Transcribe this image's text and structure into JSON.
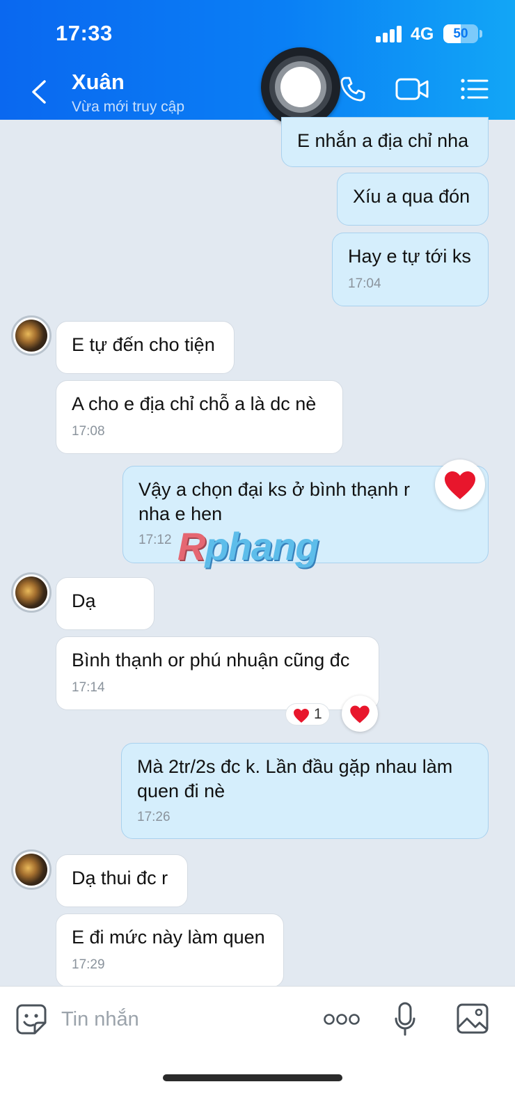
{
  "status_bar": {
    "time": "17:33",
    "network": "4G",
    "battery": "50",
    "battery_level": 0.5
  },
  "header": {
    "contact_name": "Xuân",
    "contact_status": "Vừa mới truy cập",
    "icons": [
      "chevron-left-icon",
      "phone-icon",
      "video-camera-icon",
      "list-menu-icon"
    ]
  },
  "messages": [
    {
      "direction": "out",
      "text": "E nhắn a địa chỉ nha"
    },
    {
      "direction": "out",
      "text": "Xíu a qua đón"
    },
    {
      "direction": "out",
      "text": "Hay e tự tới ks",
      "time": "17:04"
    },
    {
      "direction": "in",
      "text": "E tự đến cho tiện"
    },
    {
      "direction": "in",
      "text": "A cho e địa chỉ chỗ a là dc nè",
      "time": "17:08"
    },
    {
      "direction": "out",
      "text": "Vậy a chọn đại ks ở bình thạnh r nha e hen",
      "time": "17:12",
      "reaction": "heart"
    },
    {
      "direction": "in",
      "text": "Dạ"
    },
    {
      "direction": "in",
      "text": "Bình thạnh or phú nhuận cũng đc",
      "time": "17:14",
      "reaction": "heart",
      "reaction_count": "1"
    },
    {
      "direction": "out",
      "text": "Mà 2tr/2s đc k. Lần đầu gặp nhau làm quen đi nè",
      "time": "17:26"
    },
    {
      "direction": "in",
      "text": "Dạ thui đc r"
    },
    {
      "direction": "in",
      "text": "E đi mức này làm quen",
      "time": "17:29"
    }
  ],
  "watermark": {
    "first": "R",
    "rest": "phang"
  },
  "composer": {
    "placeholder": "Tin nhắn",
    "icons": [
      "sticker-icon",
      "more-icon",
      "microphone-icon",
      "image-icon"
    ]
  },
  "colors": {
    "header_start": "#0a68f0",
    "header_end": "#12a6f6",
    "outgoing_bubble": "#d5eefc",
    "incoming_bubble": "#ffffff",
    "chat_background": "#e2e9f1",
    "heart": "#e8162c"
  }
}
